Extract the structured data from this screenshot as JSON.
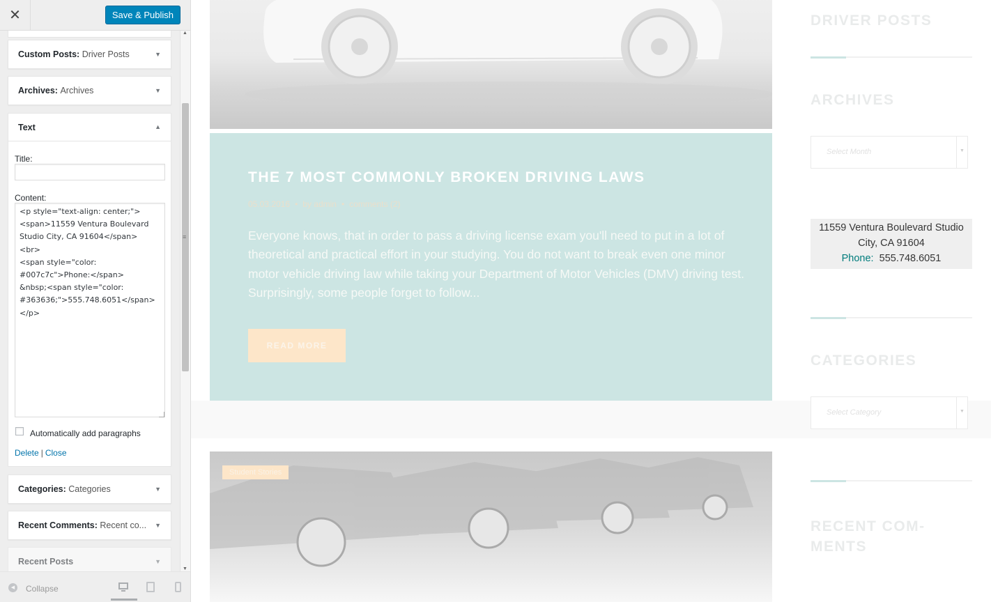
{
  "sidebar": {
    "close_glyph": "✕",
    "publish_label": "Save & Publish",
    "widgets_above": [
      {
        "title": "Custom Posts:",
        "sub": "Driver Posts"
      },
      {
        "title": "Archives:",
        "sub": "Archives"
      }
    ],
    "text_widget": {
      "title": "Text",
      "title_field_label": "Title:",
      "title_field_value": "",
      "content_label": "Content:",
      "content_value": "<p style=\"text-align: center;\">\n<span>11559 Ventura Boulevard Studio City, CA 91604</span>\n<br>\n<span style=\"color: #007c7c\">Phone:</span>\n&nbsp;<span style=\"color: #363636;\">555.748.6051</span>\n</p>",
      "autop_label": "Automatically add paragraphs",
      "autop_checked": false,
      "delete_label": "Delete",
      "separator": "|",
      "close_label": "Close"
    },
    "widgets_below": [
      {
        "title": "Categories:",
        "sub": "Categories"
      },
      {
        "title": "Recent Comments:",
        "sub": "Recent co..."
      },
      {
        "title": "Recent Posts",
        "sub": ""
      }
    ],
    "footer": {
      "collapse_label": "Collapse",
      "devices": [
        "desktop",
        "tablet",
        "mobile"
      ],
      "active_device": "desktop"
    }
  },
  "preview": {
    "post": {
      "title": "THE 7 MOST COMMONLY BROKEN DRIVING LAWS",
      "date": "05.03.2016",
      "author": "by admin",
      "comments": "comments (2)",
      "excerpt": "Everyone knows, that in order to pass a driving license exam you'll need to put in a lot of theoretical and practical effort in your studying. You do not want to break even one minor motor vehicle driving law while taking your Department of Motor Vehicles (DMV) driving test. Surprisingly, some people forget to follow...",
      "read_more": "READ MORE"
    },
    "next_post_tag": "Student Stories",
    "right_column": {
      "driver_posts_heading": "DRIVER POSTS",
      "archives_heading": "ARCHIVES",
      "archives_placeholder": "Select Month",
      "address_line1": "11559 Ventura Boulevard Studio",
      "address_line2": "City, CA 91604",
      "phone_label": "Phone:",
      "phone_value": "555.748.6051",
      "categories_heading": "CATEGORIES",
      "categories_placeholder": "Select Category",
      "recent_comments_heading_1": "RECENT COM-",
      "recent_comments_heading_2": "MENTS"
    },
    "colors": {
      "accent_teal": "#007c7c",
      "card_bg": "#cce5e3",
      "button_cream": "#fde6c9",
      "publish_blue": "#0085ba"
    }
  }
}
